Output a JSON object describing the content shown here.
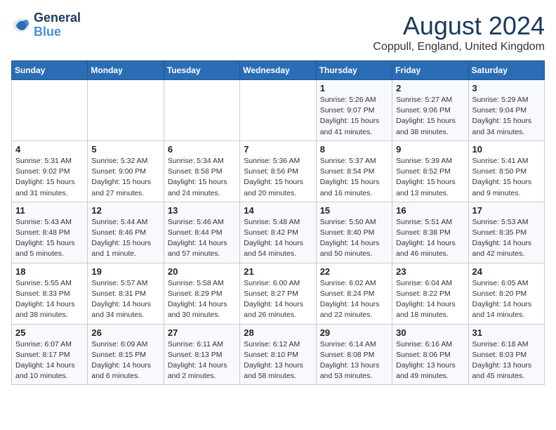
{
  "header": {
    "logo_line1": "General",
    "logo_line2": "Blue",
    "month_year": "August 2024",
    "location": "Coppull, England, United Kingdom"
  },
  "weekdays": [
    "Sunday",
    "Monday",
    "Tuesday",
    "Wednesday",
    "Thursday",
    "Friday",
    "Saturday"
  ],
  "weeks": [
    [
      {
        "day": "",
        "info": ""
      },
      {
        "day": "",
        "info": ""
      },
      {
        "day": "",
        "info": ""
      },
      {
        "day": "",
        "info": ""
      },
      {
        "day": "1",
        "info": "Sunrise: 5:26 AM\nSunset: 9:07 PM\nDaylight: 15 hours\nand 41 minutes."
      },
      {
        "day": "2",
        "info": "Sunrise: 5:27 AM\nSunset: 9:06 PM\nDaylight: 15 hours\nand 38 minutes."
      },
      {
        "day": "3",
        "info": "Sunrise: 5:29 AM\nSunset: 9:04 PM\nDaylight: 15 hours\nand 34 minutes."
      }
    ],
    [
      {
        "day": "4",
        "info": "Sunrise: 5:31 AM\nSunset: 9:02 PM\nDaylight: 15 hours\nand 31 minutes."
      },
      {
        "day": "5",
        "info": "Sunrise: 5:32 AM\nSunset: 9:00 PM\nDaylight: 15 hours\nand 27 minutes."
      },
      {
        "day": "6",
        "info": "Sunrise: 5:34 AM\nSunset: 8:58 PM\nDaylight: 15 hours\nand 24 minutes."
      },
      {
        "day": "7",
        "info": "Sunrise: 5:36 AM\nSunset: 8:56 PM\nDaylight: 15 hours\nand 20 minutes."
      },
      {
        "day": "8",
        "info": "Sunrise: 5:37 AM\nSunset: 8:54 PM\nDaylight: 15 hours\nand 16 minutes."
      },
      {
        "day": "9",
        "info": "Sunrise: 5:39 AM\nSunset: 8:52 PM\nDaylight: 15 hours\nand 13 minutes."
      },
      {
        "day": "10",
        "info": "Sunrise: 5:41 AM\nSunset: 8:50 PM\nDaylight: 15 hours\nand 9 minutes."
      }
    ],
    [
      {
        "day": "11",
        "info": "Sunrise: 5:43 AM\nSunset: 8:48 PM\nDaylight: 15 hours\nand 5 minutes."
      },
      {
        "day": "12",
        "info": "Sunrise: 5:44 AM\nSunset: 8:46 PM\nDaylight: 15 hours\nand 1 minute."
      },
      {
        "day": "13",
        "info": "Sunrise: 5:46 AM\nSunset: 8:44 PM\nDaylight: 14 hours\nand 57 minutes."
      },
      {
        "day": "14",
        "info": "Sunrise: 5:48 AM\nSunset: 8:42 PM\nDaylight: 14 hours\nand 54 minutes."
      },
      {
        "day": "15",
        "info": "Sunrise: 5:50 AM\nSunset: 8:40 PM\nDaylight: 14 hours\nand 50 minutes."
      },
      {
        "day": "16",
        "info": "Sunrise: 5:51 AM\nSunset: 8:38 PM\nDaylight: 14 hours\nand 46 minutes."
      },
      {
        "day": "17",
        "info": "Sunrise: 5:53 AM\nSunset: 8:35 PM\nDaylight: 14 hours\nand 42 minutes."
      }
    ],
    [
      {
        "day": "18",
        "info": "Sunrise: 5:55 AM\nSunset: 8:33 PM\nDaylight: 14 hours\nand 38 minutes."
      },
      {
        "day": "19",
        "info": "Sunrise: 5:57 AM\nSunset: 8:31 PM\nDaylight: 14 hours\nand 34 minutes."
      },
      {
        "day": "20",
        "info": "Sunrise: 5:58 AM\nSunset: 8:29 PM\nDaylight: 14 hours\nand 30 minutes."
      },
      {
        "day": "21",
        "info": "Sunrise: 6:00 AM\nSunset: 8:27 PM\nDaylight: 14 hours\nand 26 minutes."
      },
      {
        "day": "22",
        "info": "Sunrise: 6:02 AM\nSunset: 8:24 PM\nDaylight: 14 hours\nand 22 minutes."
      },
      {
        "day": "23",
        "info": "Sunrise: 6:04 AM\nSunset: 8:22 PM\nDaylight: 14 hours\nand 18 minutes."
      },
      {
        "day": "24",
        "info": "Sunrise: 6:05 AM\nSunset: 8:20 PM\nDaylight: 14 hours\nand 14 minutes."
      }
    ],
    [
      {
        "day": "25",
        "info": "Sunrise: 6:07 AM\nSunset: 8:17 PM\nDaylight: 14 hours\nand 10 minutes."
      },
      {
        "day": "26",
        "info": "Sunrise: 6:09 AM\nSunset: 8:15 PM\nDaylight: 14 hours\nand 6 minutes."
      },
      {
        "day": "27",
        "info": "Sunrise: 6:11 AM\nSunset: 8:13 PM\nDaylight: 14 hours\nand 2 minutes."
      },
      {
        "day": "28",
        "info": "Sunrise: 6:12 AM\nSunset: 8:10 PM\nDaylight: 13 hours\nand 58 minutes."
      },
      {
        "day": "29",
        "info": "Sunrise: 6:14 AM\nSunset: 8:08 PM\nDaylight: 13 hours\nand 53 minutes."
      },
      {
        "day": "30",
        "info": "Sunrise: 6:16 AM\nSunset: 8:06 PM\nDaylight: 13 hours\nand 49 minutes."
      },
      {
        "day": "31",
        "info": "Sunrise: 6:18 AM\nSunset: 8:03 PM\nDaylight: 13 hours\nand 45 minutes."
      }
    ]
  ]
}
